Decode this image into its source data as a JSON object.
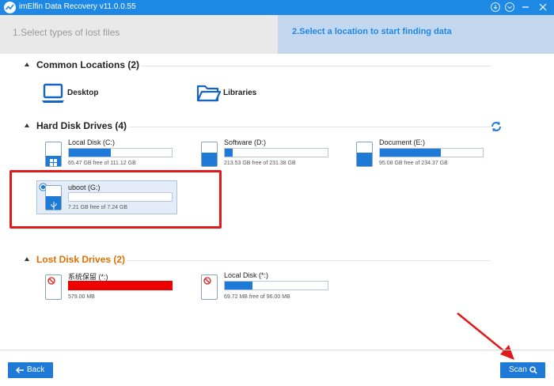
{
  "window": {
    "title": "imElfin Data Recovery v11.0.0.55"
  },
  "steps": {
    "step1": "1.Select types of lost files",
    "step2": "2.Select a location to start finding data"
  },
  "common_locations": {
    "title": "Common Locations (2)",
    "items": [
      {
        "label": "Desktop",
        "icon": "laptop-icon"
      },
      {
        "label": "Libraries",
        "icon": "folder-icon"
      }
    ]
  },
  "hard_disks": {
    "title": "Hard Disk Drives (4)",
    "refresh_icon": "refresh-icon",
    "drives": [
      {
        "name": "Local Disk (C:)",
        "free": "65.47 GB free of 111.12 GB",
        "used_fraction": 0.41,
        "fill_fraction": 0.41,
        "badge": "windows-icon"
      },
      {
        "name": "Software (D:)",
        "free": "213.53 GB free of 231.38 GB",
        "used_fraction": 0.08,
        "fill_fraction": 0.55
      },
      {
        "name": "Document (E:)",
        "free": "95.08 GB free of 234.37 GB",
        "used_fraction": 0.59,
        "fill_fraction": 0.55
      },
      {
        "name": "uboot (G:)",
        "free": "7.21 GB free of 7.24 GB",
        "used_fraction": 0.0,
        "fill_fraction": 0.55,
        "badge": "usb-icon",
        "selected": true
      }
    ]
  },
  "lost_disks": {
    "title": "Lost Disk Drives (2)",
    "drives": [
      {
        "name": "系统保留 (*:)",
        "free": "579.00 MB",
        "used_fraction": 1.0,
        "bar_color": "#ee0000"
      },
      {
        "name": "Local Disk (*:)",
        "free": "69.72 MB free of 96.00 MB",
        "used_fraction": 0.27
      }
    ]
  },
  "buttons": {
    "back": "Back",
    "scan": "Scan"
  },
  "colors": {
    "accent": "#1e7ad6",
    "titlebar": "#1e88e5",
    "lost": "#e07000",
    "highlight": "#e01a1a"
  }
}
